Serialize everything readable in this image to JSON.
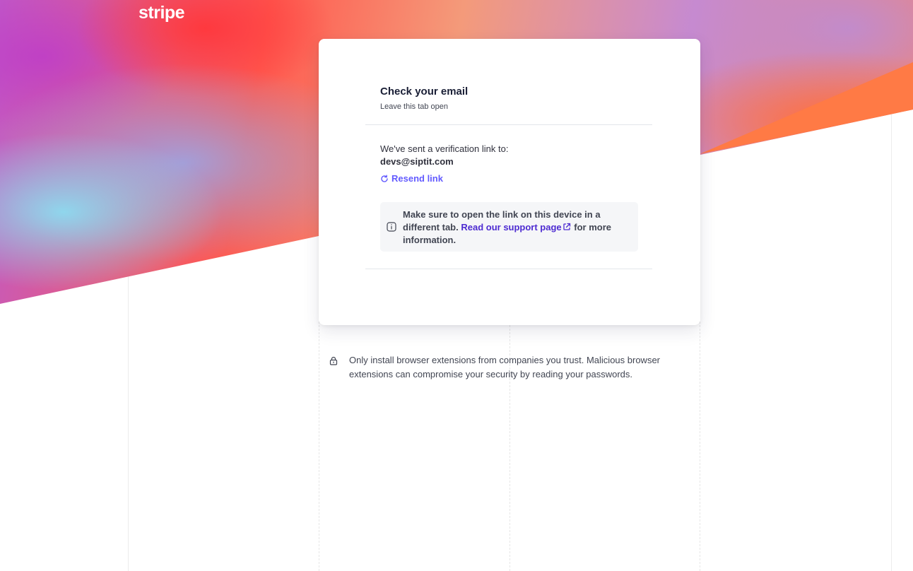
{
  "brand": {
    "logo_text": "stripe"
  },
  "card": {
    "title": "Check your email",
    "subtitle": "Leave this tab open",
    "sent_message": "We've sent a verification link to:",
    "email": "devs@siptit.com",
    "resend_label": "Resend link",
    "notice": {
      "prefix": "Make sure to open the link on this device in a different tab.",
      "link_label": "Read our support page",
      "suffix": "for more information."
    }
  },
  "security_note": "Only install browser extensions from companies you trust. Malicious browser extensions can compromise your security by reading your passwords.",
  "colors": {
    "accent": "#635bff",
    "link": "#4d2bd1",
    "text_dark": "#1a1f36",
    "notice_bg": "#f5f6f8"
  },
  "icons": {
    "resend": "refresh-icon",
    "notice": "info-icon",
    "external": "external-link-icon",
    "security": "lock-icon"
  }
}
